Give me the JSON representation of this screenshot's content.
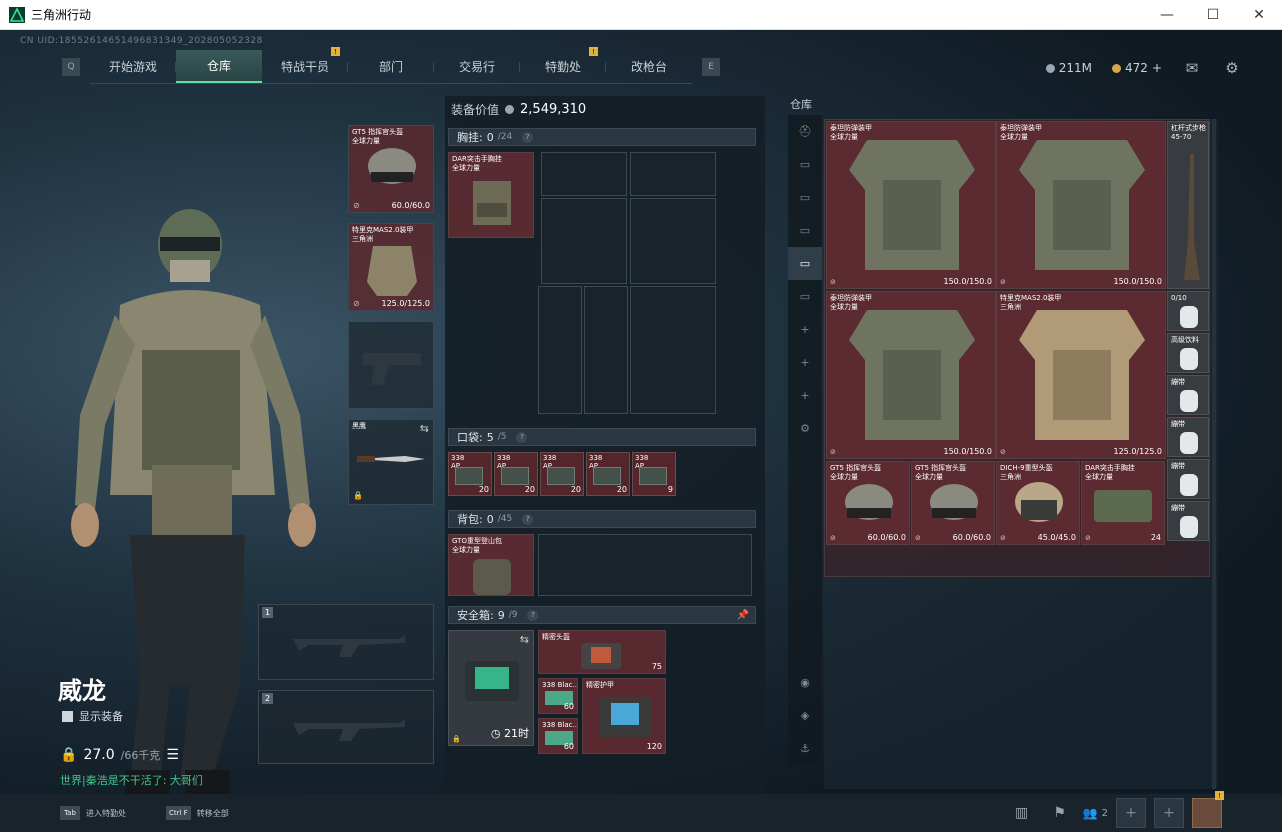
{
  "window": {
    "title": "三角洲行动",
    "min": "—",
    "max": "☐",
    "close": "✕"
  },
  "uid": "CN UID:18552614651496831349_202805052328",
  "nav": {
    "left_key": "Q",
    "right_key": "E",
    "tabs": [
      {
        "label": "开始游戏",
        "notif": ""
      },
      {
        "label": "仓库",
        "notif": ""
      },
      {
        "label": "特战干员",
        "notif": "!"
      },
      {
        "label": "部门",
        "notif": ""
      },
      {
        "label": "交易行",
        "notif": ""
      },
      {
        "label": "特勤处",
        "notif": "!"
      },
      {
        "label": "改枪台",
        "notif": ""
      }
    ],
    "active_tab": 1
  },
  "currency": {
    "silver": "211M",
    "gold": "472",
    "gold_add": "+"
  },
  "character": {
    "name": "威龙",
    "show_equip": "显示装备",
    "weight": "27.0",
    "weight_max": "/66千克",
    "chat": "世界|秦浩是不干活了: 大哥们"
  },
  "equip_slots": {
    "helmet": {
      "label": "GT5 指挥官头盔\n全球力量",
      "durability": "60.0/60.0"
    },
    "armor": {
      "label": "特里克MAS2.0装甲\n三角洲",
      "durability": "125.0/125.0"
    },
    "melee": {
      "label": "黑鹰",
      "swap": "⇆"
    },
    "slot1": "1",
    "slot2": "2"
  },
  "mid": {
    "value_label": "装备价值",
    "value": "2,549,310",
    "chest": {
      "title": "胸挂:",
      "count": "0",
      "cap": "/24",
      "item": "DAR突击手胸挂\n全球力量"
    },
    "pocket": {
      "title": "口袋:",
      "count": "5",
      "cap": "/5"
    },
    "ammo": [
      {
        "label": "338\nAP",
        "count": "20"
      },
      {
        "label": "338\nAP",
        "count": "20"
      },
      {
        "label": "338\nAP",
        "count": "20"
      },
      {
        "label": "338\nAP",
        "count": "20"
      },
      {
        "label": "338\nAP",
        "count": "9"
      }
    ],
    "backpack": {
      "title": "背包:",
      "count": "0",
      "cap": "/45",
      "item": "GTO重型登山包\n全球力量"
    },
    "safe": {
      "title": "安全箱:",
      "count": "9",
      "cap": "/9",
      "time": "21时",
      "items": [
        {
          "label": "精密头盔",
          "dur": "75"
        },
        {
          "label": "338 Blac..",
          "count": "60"
        },
        {
          "label": "精密护甲",
          "dur": "120"
        },
        {
          "label": "338 Blac..",
          "count": "60"
        }
      ]
    }
  },
  "storage": {
    "title": "仓库",
    "side_tabs": [
      "⛑",
      "▭",
      "▭",
      "▭",
      "▭",
      "▭",
      "+",
      "+",
      "+",
      "⚙"
    ],
    "side_bottom": [
      "◉",
      "◈",
      "⚓"
    ],
    "items": [
      {
        "label": "泰坦防弹装甲\n全球力量",
        "dur": "150.0/150.0"
      },
      {
        "label": "泰坦防弹装甲\n全球力量",
        "dur": "150.0/150.0"
      },
      {
        "label": "泰坦防弹装甲\n全球力量",
        "dur": "150.0/150.0"
      },
      {
        "label": "特里克MAS2.0装甲\n三角洲",
        "dur": "125.0/125.0"
      },
      {
        "label": "GT5 指挥官头盔\n全球力量",
        "dur": "60.0/60.0"
      },
      {
        "label": "GT5 指挥官头盔\n全球力量",
        "dur": "60.0/60.0"
      },
      {
        "label": "DICH-9重型头盔\n三角洲",
        "dur": "45.0/45.0"
      },
      {
        "label": "DAR突击手胸挂\n全球力量",
        "dur": "24"
      }
    ],
    "rifle": {
      "label": "杠杆式步枪\n45-70"
    },
    "consumables": [
      {
        "label": "0/10"
      },
      {
        "label": "高级饮料"
      },
      {
        "label": "繃带"
      },
      {
        "label": "繃带"
      },
      {
        "label": "繃带"
      },
      {
        "label": "繃带"
      }
    ]
  },
  "bottom": {
    "keys": [
      {
        "key": "Tab",
        "label": "进入特勤处"
      },
      {
        "key": "Ctrl F",
        "label": "转移全部"
      }
    ],
    "friends_count": "2",
    "avatar_badge": "!"
  }
}
